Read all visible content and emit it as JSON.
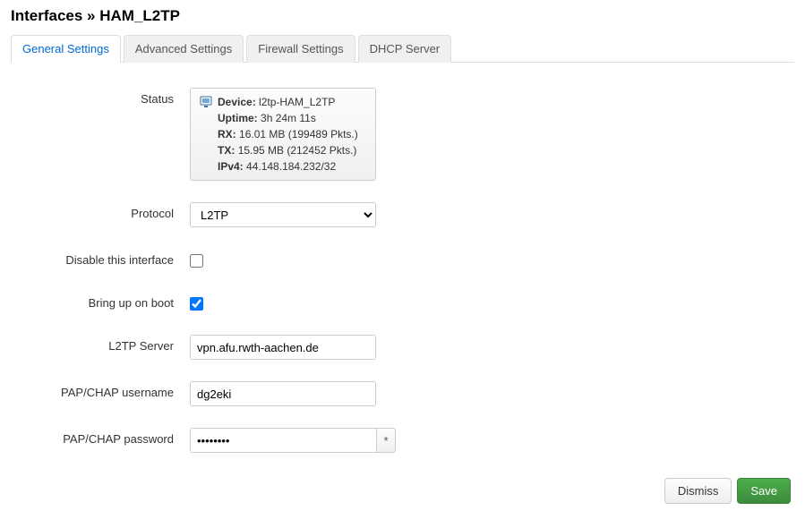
{
  "header": {
    "prefix": "Interfaces » ",
    "title": "HAM_L2TP"
  },
  "tabs": {
    "general": "General Settings",
    "advanced": "Advanced Settings",
    "firewall": "Firewall Settings",
    "dhcp": "DHCP Server"
  },
  "labels": {
    "status": "Status",
    "protocol": "Protocol",
    "disable": "Disable this interface",
    "bringup": "Bring up on boot",
    "server": "L2TP Server",
    "username": "PAP/CHAP username",
    "password": "PAP/CHAP password"
  },
  "status": {
    "device_label": "Device:",
    "device_value": "l2tp-HAM_L2TP",
    "uptime_label": "Uptime:",
    "uptime_value": "3h 24m 11s",
    "rx_label": "RX:",
    "rx_value": "16.01 MB (199489 Pkts.)",
    "tx_label": "TX:",
    "tx_value": "15.95 MB (212452 Pkts.)",
    "ipv4_label": "IPv4:",
    "ipv4_value": "44.148.184.232/32"
  },
  "form": {
    "protocol": "L2TP",
    "server": "vpn.afu.rwth-aachen.de",
    "username": "dg2eki",
    "password": "••••••••",
    "reveal": "*"
  },
  "buttons": {
    "dismiss": "Dismiss",
    "save": "Save"
  }
}
